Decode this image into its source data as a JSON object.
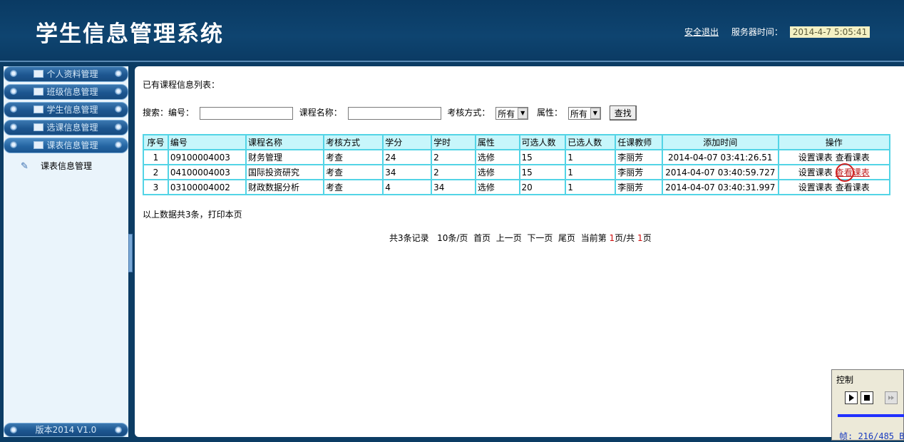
{
  "header": {
    "title": "学生信息管理系统",
    "logout": "安全退出",
    "server_time_label": "服务器时间：",
    "server_time": "2014-4-7 5:05:41"
  },
  "sidebar": {
    "items": [
      {
        "label": "个人资料管理"
      },
      {
        "label": "班级信息管理"
      },
      {
        "label": "学生信息管理"
      },
      {
        "label": "选课信息管理"
      },
      {
        "label": "课表信息管理"
      }
    ],
    "submenu": "课表信息管理",
    "version": "版本2014 V1.0"
  },
  "content": {
    "list_title": "已有课程信息列表：",
    "search": {
      "label": "搜索：",
      "code_label": "编号：",
      "name_label": "课程名称：",
      "exam_label": "考核方式：",
      "exam_value": "所有",
      "attr_label": "属性：",
      "attr_value": "所有",
      "button": "查找"
    },
    "table": {
      "headers": [
        "序号",
        "编号",
        "课程名称",
        "考核方式",
        "学分",
        "学时",
        "属性",
        "可选人数",
        "已选人数",
        "任课教师",
        "添加时间",
        "操作"
      ],
      "rows": [
        [
          "1",
          "09100004003",
          "财务管理",
          "考查",
          "24",
          "2",
          "选修",
          "15",
          "1",
          "李丽芳",
          "2014-04-07 03:41:26.51"
        ],
        [
          "2",
          "04100004003",
          "国际投资研究",
          "考查",
          "34",
          "2",
          "选修",
          "15",
          "1",
          "李丽芳",
          "2014-04-07 03:40:59.727"
        ],
        [
          "3",
          "03100004002",
          "财政数据分析",
          "考查",
          "4",
          "34",
          "选修",
          "20",
          "1",
          "李丽芳",
          "2014-04-07 03:40:31.997"
        ]
      ],
      "op_set": "设置课表",
      "op_view": "查看课表"
    },
    "summary": "以上数据共3条，打印本页",
    "pager": {
      "total": "共3条记录",
      "per_page": "10条/页",
      "first": "首页",
      "prev": "上一页",
      "next": "下一页",
      "last": "尾页",
      "current_prefix": "当前第",
      "current": "1",
      "of": "页/共",
      "total_pages": "1",
      "suffix": "页"
    }
  },
  "control": {
    "title": "控制",
    "frame": "帧: 216/485 B"
  }
}
